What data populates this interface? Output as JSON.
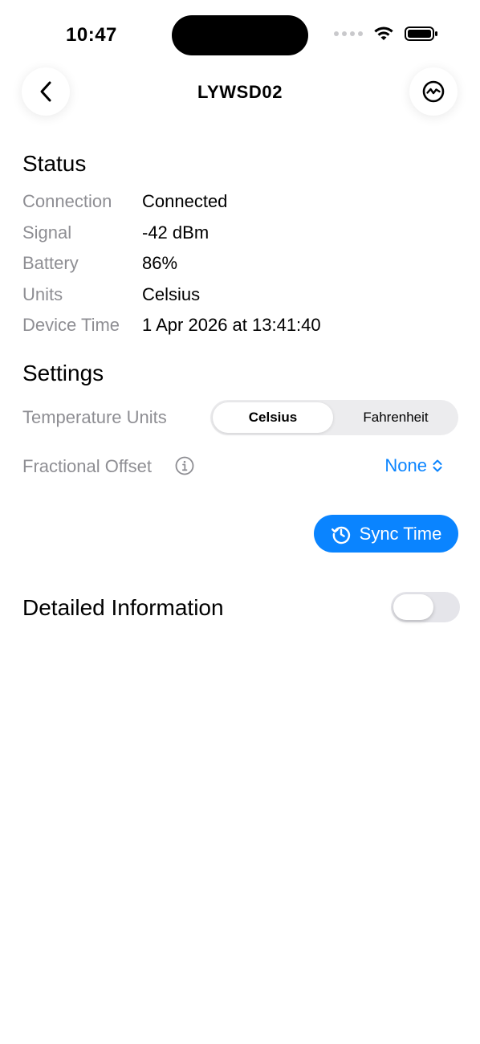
{
  "status_bar": {
    "time": "10:47",
    "icons": [
      "cellular-dots-icon",
      "wifi-icon",
      "battery-icon"
    ]
  },
  "nav": {
    "title": "LYWSD02",
    "back_icon": "chevron-left-icon",
    "right_icon": "activity-icon"
  },
  "status": {
    "title": "Status",
    "rows": [
      {
        "label": "Connection",
        "value": "Connected"
      },
      {
        "label": "Signal",
        "value": "-42 dBm"
      },
      {
        "label": "Battery",
        "value": "86%"
      },
      {
        "label": "Units",
        "value": "Celsius"
      },
      {
        "label": "Device Time",
        "value": "1 Apr 2026 at 13:41:40"
      }
    ]
  },
  "settings": {
    "title": "Settings",
    "temperature_units_label": "Temperature Units",
    "temperature_units_options": [
      "Celsius",
      "Fahrenheit"
    ],
    "temperature_units_selected": "Celsius",
    "fractional_offset_label": "Fractional Offset",
    "fractional_offset_value": "None",
    "sync_button_label": "Sync Time"
  },
  "detailed": {
    "label": "Detailed Information",
    "enabled": false
  },
  "colors": {
    "accent": "#0a84ff",
    "secondary_text": "#8e8e93",
    "toggle_off": "#e5e5ea"
  }
}
